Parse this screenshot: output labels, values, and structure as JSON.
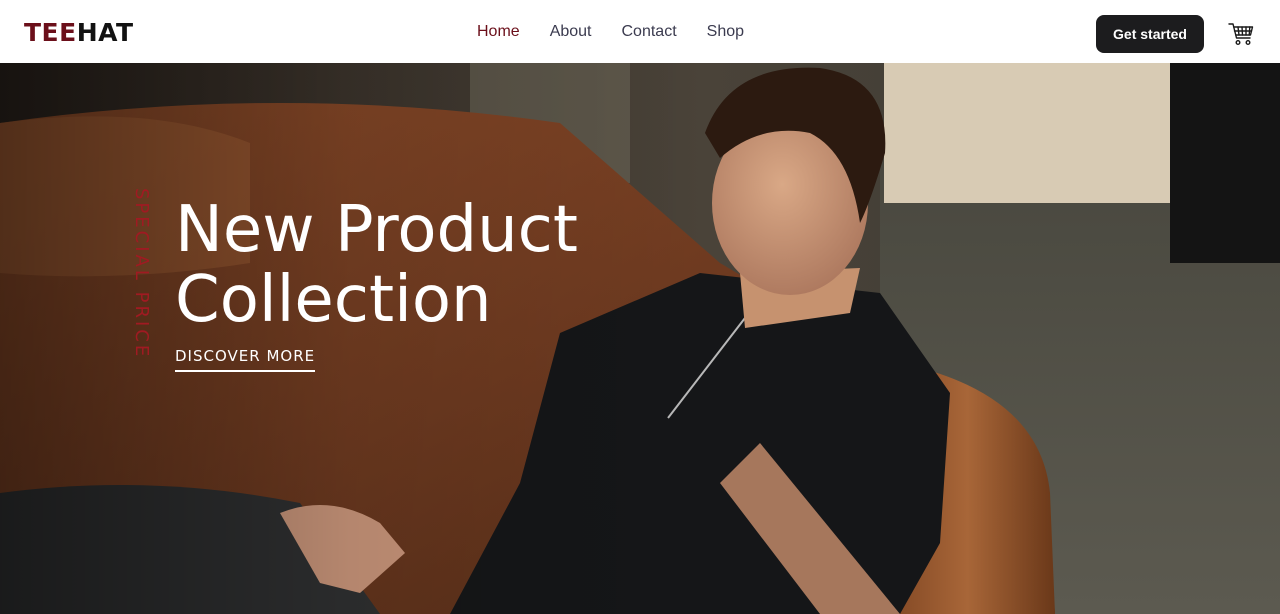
{
  "brand": {
    "part1": "TEE",
    "part2": "HAT",
    "color_accent": "#6b0f1a"
  },
  "nav": {
    "items": [
      {
        "label": "Home",
        "active": true
      },
      {
        "label": "About",
        "active": false
      },
      {
        "label": "Contact",
        "active": false
      },
      {
        "label": "Shop",
        "active": false
      }
    ]
  },
  "header": {
    "cta_label": "Get started",
    "cart_icon": "shopping-cart-icon"
  },
  "hero": {
    "vertical_text": "SPECIAL PRICE",
    "headline_line1": "New Product",
    "headline_line2": "Collection",
    "link_label": "DISCOVER MORE",
    "image_subject": "man in black zip polo shirt seated on brown leather sofa",
    "vertical_text_color": "#a01a22"
  }
}
